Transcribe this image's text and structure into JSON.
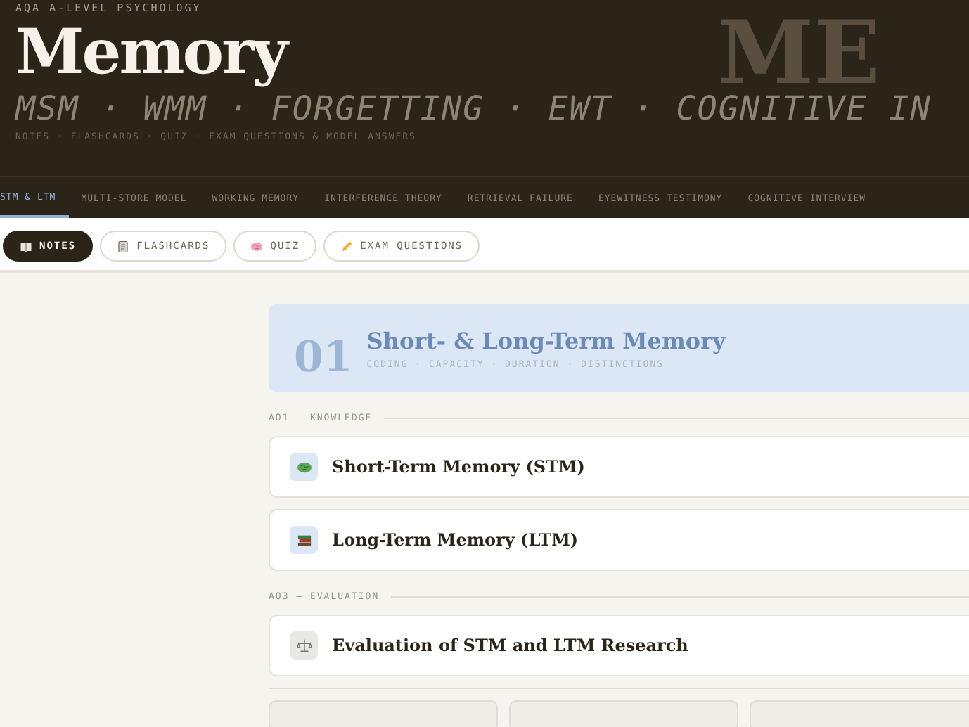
{
  "header": {
    "kicker": "AQA A-LEVEL PSYCHOLOGY",
    "title": "Memory",
    "topics": "MSM · WMM · FORGETTING · EWT · COGNITIVE IN",
    "contents": "NOTES · FLASHCARDS · QUIZ · EXAM QUESTIONS & MODEL ANSWERS",
    "backdrop": "ME"
  },
  "tabs": [
    {
      "label": "STM & LTM",
      "selected": true
    },
    {
      "label": "MULTI-STORE MODEL",
      "selected": false
    },
    {
      "label": "WORKING MEMORY",
      "selected": false
    },
    {
      "label": "INTERFERENCE THEORY",
      "selected": false
    },
    {
      "label": "RETRIEVAL FAILURE",
      "selected": false
    },
    {
      "label": "EYEWITNESS TESTIMONY",
      "selected": false
    },
    {
      "label": "COGNITIVE INTERVIEW",
      "selected": false
    }
  ],
  "modes": [
    {
      "label": "NOTES",
      "kind": "book",
      "selected": true
    },
    {
      "label": "FLASHCARDS",
      "kind": "cards",
      "selected": false
    },
    {
      "label": "QUIZ",
      "kind": "brain",
      "selected": false
    },
    {
      "label": "EXAM QUESTIONS",
      "kind": "pencil",
      "selected": false
    }
  ],
  "section": {
    "number": "01",
    "title": "Short- & Long-Term Memory",
    "subtitle": "CODING · CAPACITY · DURATION · DISTINCTIONS"
  },
  "groups": [
    {
      "heading": "AO1 — KNOWLEDGE",
      "items": [
        {
          "title": "Short-Term Memory (STM)",
          "kind": "brain"
        },
        {
          "title": "Long-Term Memory (LTM)",
          "kind": "books"
        }
      ]
    },
    {
      "heading": "AO3 — EVALUATION",
      "items": [
        {
          "title": "Evaluation of STM and LTM Research",
          "kind": "scales"
        }
      ]
    }
  ]
}
